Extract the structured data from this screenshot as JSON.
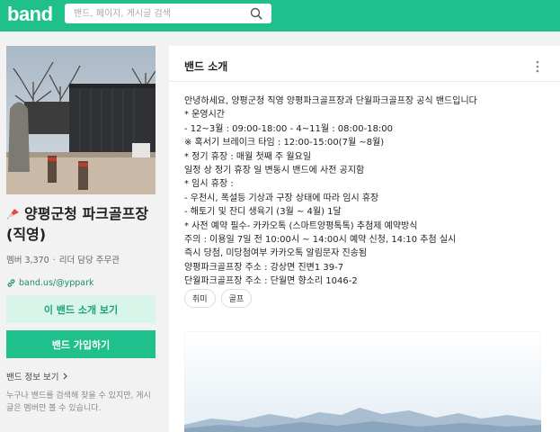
{
  "header": {
    "logo": "band",
    "search_placeholder": "밴드, 페이지, 게시글 검색"
  },
  "band": {
    "name": "양평군청 파크골프장 (직영)",
    "members_label": "멤버 3,370",
    "leader_label": "리더 담당 주무관",
    "link": "band.us/@yppark",
    "intro_button": "이 밴드 소개 보기",
    "join_button": "밴드 가입하기",
    "info_link": "밴드 정보 보기",
    "info_desc": "누구나 밴드를 검색해 찾을 수 있지만, 게시글은 멤버만 볼 수 있습니다."
  },
  "panel": {
    "title": "밴드 소개",
    "lines": [
      "안녕하세요, 양평군청 직영 양평파크골프장과 단월파크골프장 공식 밴드입니다",
      "* 운영시간",
      "- 12~3월 : 09:00-18:00 - 4~11월 : 08:00-18:00",
      "※ 혹서기 브레이크 타임 : 12:00-15:00(7월 ~8월)",
      "* 정기 휴장 : 매월 첫째 주 월요일",
      "일정 상 정기 휴장 일 변동시 밴드에 사전 공지함",
      "* 임시 휴장 :",
      "- 우천시, 폭설등 기상과 구장 상태에 따라 임시 휴장",
      "- 해토기 및 잔디 생육기 (3월 ~ 4월) 1달",
      "* 사전 예약 필수- 카카오톡 (스마트양평톡톡) 추첨제 예약방식",
      " 주의 : 이용일 7일 전 10:00시 ~ 14:00시 예약 신청, 14:10 추첨 실시",
      "즉시 당첨, 미당첨여부 카카오톡 알림문자 진송됨",
      "양평파크골프장 주소 : 강상면 진변1 39-7",
      "단월파크골프장 주소 : 단월면 향소리 1046-2"
    ],
    "tags": [
      "취미",
      "골프"
    ]
  },
  "colors": {
    "brand": "#20c08d",
    "intro_button_bg": "#d9f5ea"
  }
}
